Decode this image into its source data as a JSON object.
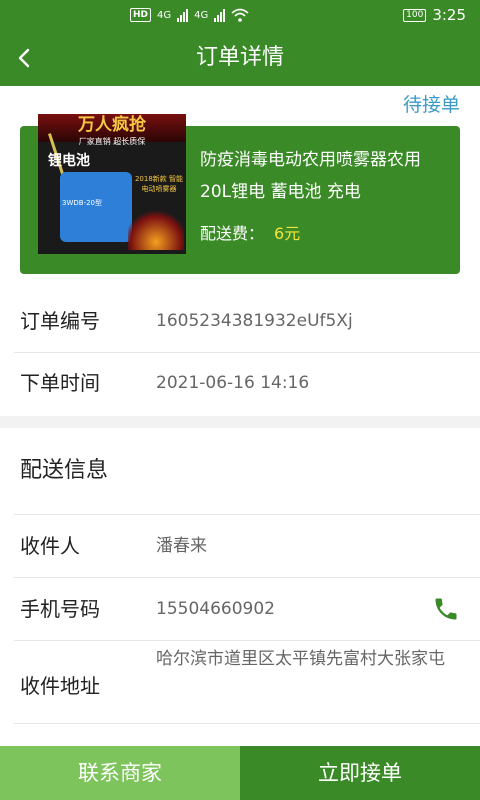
{
  "status_bar": {
    "hd_label": "HD",
    "network_1": "4G",
    "network_2": "4G",
    "battery": "100",
    "time": "3:25"
  },
  "header": {
    "title": "订单详情",
    "back_icon": "chevron-left-icon"
  },
  "order": {
    "status": "待接单",
    "product": {
      "name": "防疫消毒电动农用喷雾器农用20L锂电 蓄电池 充电",
      "fee_label": "配送费：",
      "fee_value": "6元",
      "image_text": {
        "banner": "万人疯抢",
        "sub": "厂家直销 超长质保",
        "title": "锂电池",
        "model": "3WDB-20型",
        "side": "2018新款 智能电动喷雾器"
      }
    },
    "number_label": "订单编号",
    "number_value": "1605234381932eUf5Xj",
    "time_label": "下单时间",
    "time_value": "2021-06-16 14:16"
  },
  "delivery": {
    "section_title": "配送信息",
    "recipient_label": "收件人",
    "recipient_value": "潘春来",
    "phone_label": "手机号码",
    "phone_value": "15504660902",
    "address_label": "收件地址",
    "address_value": "哈尔滨市道里区太平镇先富村大张家屯"
  },
  "actions": {
    "contact_label": "联系商家",
    "accept_label": "立即接单"
  },
  "colors": {
    "primary": "#3a8a27",
    "secondary_button": "#7ec45c",
    "status_text": "#3b9bc4",
    "fee_highlight": "#f6e33a",
    "phone_icon": "#3a8a27"
  }
}
